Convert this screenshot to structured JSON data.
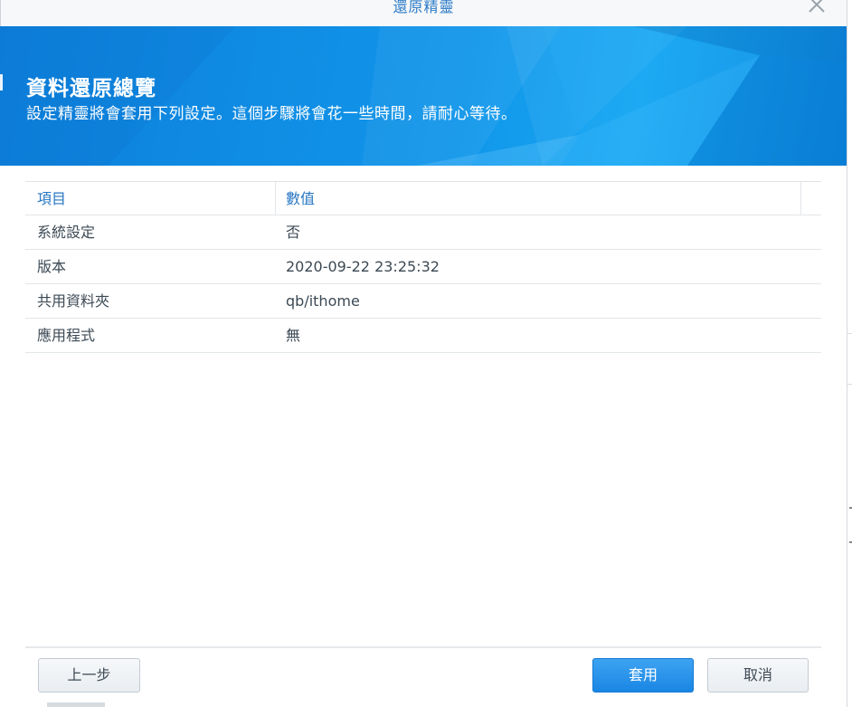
{
  "window": {
    "title": "還原精靈"
  },
  "banner": {
    "heading": "資料還原總覽",
    "subtitle": "設定精靈將會套用下列設定。這個步驟將會花一些時間，請耐心等待。"
  },
  "table": {
    "columns": [
      "項目",
      "數值"
    ],
    "rows": [
      {
        "item": "系統設定",
        "value": "否"
      },
      {
        "item": "版本",
        "value": "2020-09-22 23:25:32"
      },
      {
        "item": "共用資料夾",
        "value": "qb/ithome"
      },
      {
        "item": "應用程式",
        "value": "無"
      }
    ]
  },
  "footer": {
    "prev_label": "上一步",
    "apply_label": "套用",
    "cancel_label": "取消"
  },
  "colors": {
    "accent": "#1a86e4",
    "banner": "#1196ea",
    "header_text": "#2777c4",
    "body_text": "#3c4954"
  },
  "icons": {
    "close": "close-icon"
  }
}
